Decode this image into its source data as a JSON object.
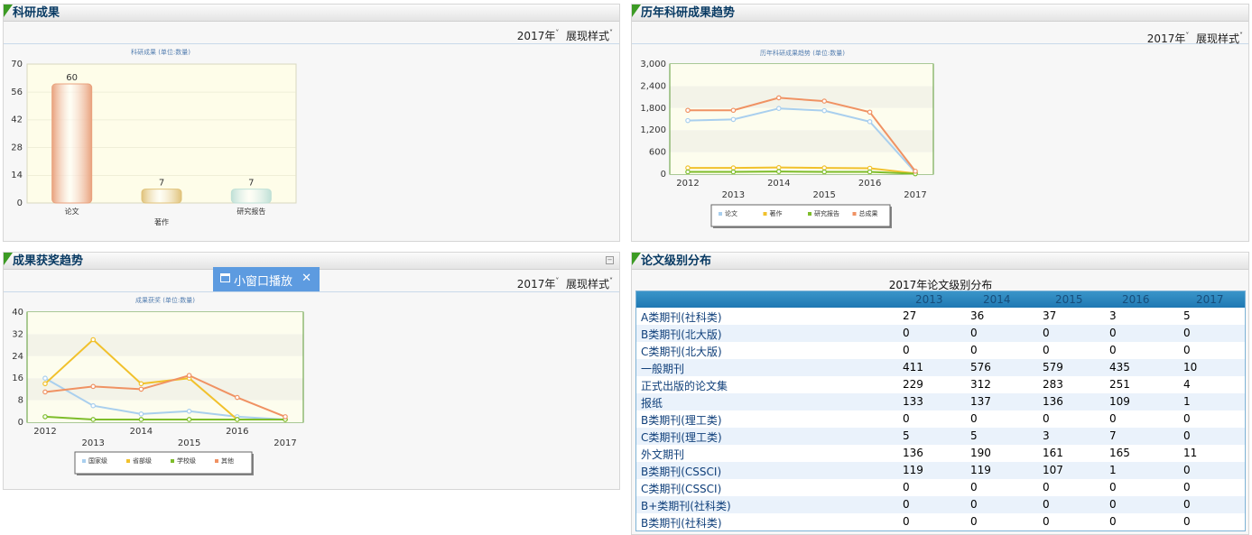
{
  "panels": {
    "research": {
      "title": "科研成果",
      "year_label": "2017年",
      "style_label": "展现样式",
      "marker": "˅"
    },
    "trend": {
      "title": "历年科研成果趋势",
      "year_label": "2017年",
      "style_label": "展现样式",
      "marker": "˅"
    },
    "award": {
      "title": "成果获奖趋势",
      "year_label": "2017年",
      "style_label": "展现样式",
      "marker": "˅"
    },
    "level": {
      "title": "论文级别分布",
      "table_caption": "2017年论文级别分布"
    }
  },
  "popup": {
    "label": "小窗口播放",
    "close": "✕"
  },
  "chart_data": [
    {
      "type": "bar",
      "title": "科研成果 (单位:数量)",
      "categories": [
        "论文",
        "著作",
        "研究报告"
      ],
      "values": [
        60,
        7,
        7
      ],
      "data_labels": [
        "60",
        "7",
        "7"
      ],
      "ylim": [
        0,
        70
      ],
      "yticks": [
        "0",
        "14",
        "28",
        "42",
        "56",
        "70"
      ],
      "colors": [
        "#e9a27e",
        "#e0c27a",
        "#bfe0d6"
      ]
    },
    {
      "type": "line",
      "title": "历年科研成果趋势 (单位:数量)",
      "x": [
        "2012",
        "2013",
        "2014",
        "2015",
        "2016",
        "2017"
      ],
      "ylim": [
        0,
        3000
      ],
      "yticks": [
        "0",
        "600",
        "1,200",
        "1,800",
        "2,400",
        "3,000"
      ],
      "series": [
        {
          "name": "论文",
          "color": "#a9cfee",
          "values": [
            1460,
            1490,
            1790,
            1730,
            1430,
            50
          ]
        },
        {
          "name": "著作",
          "color": "#f1c12c",
          "values": [
            170,
            170,
            180,
            170,
            160,
            20
          ]
        },
        {
          "name": "研究报告",
          "color": "#7ebd2b",
          "values": [
            60,
            60,
            70,
            60,
            60,
            10
          ]
        },
        {
          "name": "总成果",
          "color": "#f09263",
          "values": [
            1740,
            1740,
            2080,
            1990,
            1690,
            80
          ]
        }
      ]
    },
    {
      "type": "line",
      "title": "成果获奖 (单位:数量)",
      "x": [
        "2012",
        "2013",
        "2014",
        "2015",
        "2016",
        "2017"
      ],
      "ylim": [
        0,
        40
      ],
      "yticks": [
        "0",
        "8",
        "16",
        "24",
        "32",
        "40"
      ],
      "series": [
        {
          "name": "国家级",
          "color": "#a9cfee",
          "values": [
            16,
            6,
            3,
            4,
            2,
            1
          ]
        },
        {
          "name": "省部级",
          "color": "#f1c12c",
          "values": [
            14,
            30,
            14,
            16,
            1,
            1
          ]
        },
        {
          "name": "学校级",
          "color": "#7ebd2b",
          "values": [
            2,
            1,
            1,
            1,
            1,
            1
          ]
        },
        {
          "name": "其他",
          "color": "#f09263",
          "values": [
            11,
            13,
            12,
            17,
            9,
            2
          ]
        }
      ]
    }
  ],
  "level_table": {
    "headers": [
      "",
      "2013",
      "2014",
      "2015",
      "2016",
      "2017"
    ],
    "rows": [
      [
        "A类期刊(社科类)",
        "27",
        "36",
        "37",
        "3",
        "5"
      ],
      [
        "B类期刊(北大版)",
        "0",
        "0",
        "0",
        "0",
        "0"
      ],
      [
        "C类期刊(北大版)",
        "0",
        "0",
        "0",
        "0",
        "0"
      ],
      [
        "一般期刊",
        "411",
        "576",
        "579",
        "435",
        "10"
      ],
      [
        "正式出版的论文集",
        "229",
        "312",
        "283",
        "251",
        "4"
      ],
      [
        "报纸",
        "133",
        "137",
        "136",
        "109",
        "1"
      ],
      [
        "B类期刊(理工类)",
        "0",
        "0",
        "0",
        "0",
        "0"
      ],
      [
        "C类期刊(理工类)",
        "5",
        "5",
        "3",
        "7",
        "0"
      ],
      [
        "外文期刊",
        "136",
        "190",
        "161",
        "165",
        "11"
      ],
      [
        "B类期刊(CSSCI)",
        "119",
        "119",
        "107",
        "1",
        "0"
      ],
      [
        "C类期刊(CSSCI)",
        "0",
        "0",
        "0",
        "0",
        "0"
      ],
      [
        "B+类期刊(社科类)",
        "0",
        "0",
        "0",
        "0",
        "0"
      ],
      [
        "B类期刊(社科类)",
        "0",
        "0",
        "0",
        "0",
        "0"
      ]
    ]
  }
}
